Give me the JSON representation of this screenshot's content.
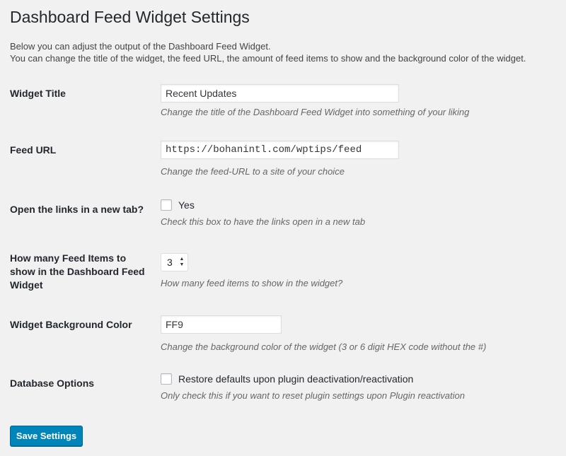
{
  "page": {
    "title": "Dashboard Feed Widget Settings",
    "intro_line1": "Below you can adjust the output of the Dashboard Feed Widget.",
    "intro_line2": "You can change the title of the widget, the feed URL, the amount of feed items to show and the background color of the widget."
  },
  "fields": {
    "widget_title": {
      "label": "Widget Title",
      "value": "Recent Updates",
      "description": "Change the title of the Dashboard Feed Widget into something of your liking"
    },
    "feed_url": {
      "label": "Feed URL",
      "value": "https://bohanintl.com/wptips/feed",
      "description": "Change the feed-URL to a site of your choice"
    },
    "open_new_tab": {
      "label": "Open the links in a new tab?",
      "checkbox_label": "Yes",
      "checked": false,
      "description": "Check this box to have the links open in a new tab"
    },
    "feed_items": {
      "label": "How many Feed Items to show in the Dashboard Feed Widget",
      "value": "3",
      "description": "How many feed items to show in the widget?"
    },
    "background_color": {
      "label": "Widget Background Color",
      "value": "FF9",
      "description": "Change the background color of the widget (3 or 6 digit HEX code without the #)"
    },
    "database_options": {
      "label": "Database Options",
      "checkbox_label": "Restore defaults upon plugin deactivation/reactivation",
      "checked": false,
      "description": "Only check this if you want to reset plugin settings upon Plugin reactivation"
    }
  },
  "actions": {
    "save_label": "Save Settings"
  },
  "colors": {
    "background": "#f1f1f1",
    "primary_button": "#0085ba",
    "description_text": "#666666"
  }
}
